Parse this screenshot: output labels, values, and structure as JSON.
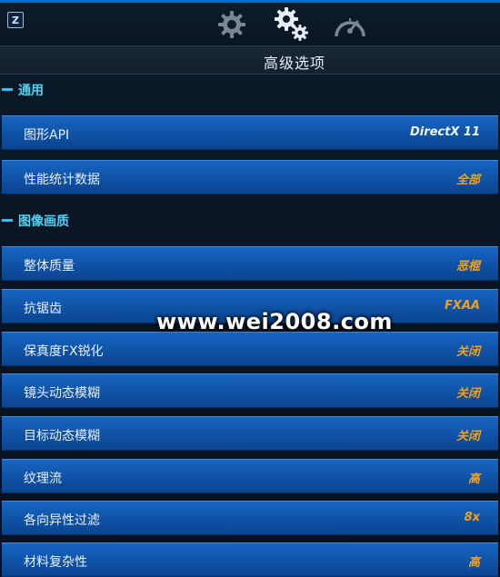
{
  "topbar": {
    "z_key": "Z",
    "tabs": [
      {
        "icon": "gear-icon"
      },
      {
        "icon": "gears-icon"
      },
      {
        "icon": "speedometer-icon"
      }
    ]
  },
  "title": "高级选项",
  "sections": [
    {
      "label": "通用",
      "rows": [
        {
          "name": "图形API",
          "value": "DirectX 11"
        },
        {
          "name": "性能统计数据",
          "value": "全部"
        }
      ]
    },
    {
      "label": "图像画质",
      "rows": [
        {
          "name": "整体质量",
          "value": "恶棍"
        },
        {
          "name": "抗锯齿",
          "value": "FXAA"
        },
        {
          "name": "保真度FX锐化",
          "value": "关闭"
        },
        {
          "name": "镜头动态模糊",
          "value": "关闭"
        },
        {
          "name": "目标动态模糊",
          "value": "关闭"
        },
        {
          "name": "纹理流",
          "value": "高"
        },
        {
          "name": "各向异性过滤",
          "value": "8x"
        },
        {
          "name": "材料复杂性",
          "value": "高"
        }
      ]
    }
  ],
  "watermark": "www.wei2008.com",
  "colors": {
    "accent": "#2ec4f0",
    "row_blue": "#1260b8",
    "value_orange": "#f0a020"
  }
}
